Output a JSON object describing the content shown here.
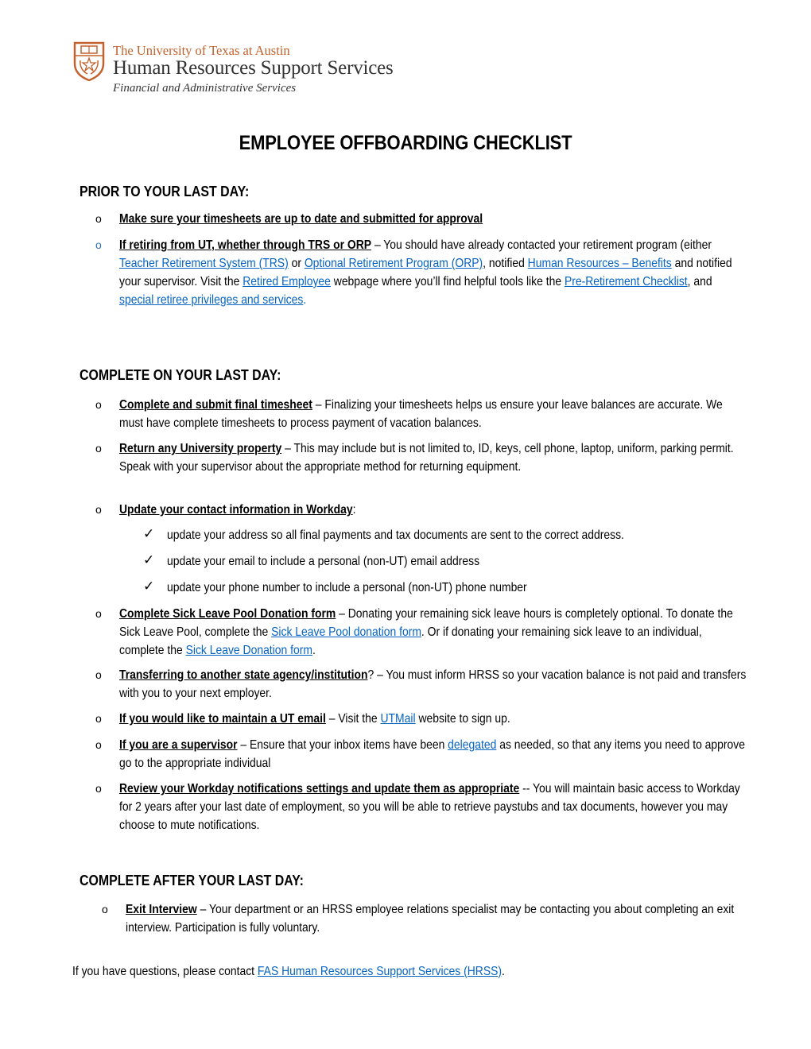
{
  "header": {
    "logo_icon": "ut-shield-icon",
    "line1": "The University of Texas at Austin",
    "line2": "Human Resources Support Services",
    "line3": "Financial and Administrative Services"
  },
  "title": "EMPLOYEE OFFBOARDING CHECKLIST",
  "colors": {
    "link": "#0563c1",
    "brand_orange": "#c4622d"
  },
  "sections": [
    {
      "heading": "PRIOR TO YOUR LAST DAY:",
      "items": [
        {
          "lead": "Make sure your timesheets are up to date and submitted for approval"
        },
        {
          "lead": "If retiring from UT, whether through TRS or ORP",
          "t1": " – You should have already contacted your retirement program (either ",
          "link1": "Teacher Retirement System (TRS)",
          "t2": " or ",
          "link2": "Optional Retirement Program (ORP)",
          "t3": ", notified ",
          "link3": "Human Resources – Benefits",
          "t4": " and notified your supervisor.  Visit the ",
          "link4": "Retired Employee",
          "t5": " webpage where you’ll find helpful tools like the ",
          "link5": "Pre-Retirement Checklist",
          "t6": ", and ",
          "link6": "special retiree privileges and services",
          "t7": "."
        }
      ]
    },
    {
      "heading": "COMPLETE ON YOUR LAST DAY:",
      "items": [
        {
          "lead": "Complete and submit final timesheet",
          "t1": " – Finalizing your timesheets helps us ensure your leave balances are accurate. We must have complete timesheets to process payment of vacation balances."
        },
        {
          "lead": "Return any University property",
          "t1": " – This may include but is not limited to, ID, keys, cell phone, laptop, uniform, parking permit. Speak with your supervisor about the appropriate method for returning equipment."
        },
        {
          "lead": "Update your contact information in Workday",
          "t1": ":",
          "subitems": [
            "update your address so all final payments and tax documents are sent to the correct address.",
            "update your email to include a personal (non-UT) email address",
            "update your phone number to include a personal (non-UT) phone number"
          ]
        },
        {
          "lead": "Complete Sick Leave Pool Donation form",
          "t1": " – Donating your remaining sick leave hours is completely optional. To donate the Sick Leave Pool, complete the ",
          "link1": "Sick Leave Pool donation form",
          "t2": ". Or if donating your remaining sick leave to an individual, complete the ",
          "link2": "Sick Leave Donation form",
          "t3": "."
        },
        {
          "lead": "Transferring to another state agency/institution",
          "t1": "? – You must inform HRSS so your vacation balance is not paid and transfers with you to your next employer."
        },
        {
          "lead": "If you would like to maintain a UT email",
          "t1": " – Visit the ",
          "link1": "UTMail",
          "t2": " website to sign up."
        },
        {
          "lead": "If you are a supervisor",
          "t1": " – Ensure that your inbox items have been ",
          "link1": "delegated",
          "t2": " as needed, so that any items you need to approve go to the appropriate individual"
        },
        {
          "lead": "Review your Workday notifications settings and update them as appropriate",
          "t1": " -- You will maintain basic access to Workday for 2 years after your last date of employment, so you will be able to retrieve paystubs and tax documents, however you may choose to mute notifications."
        }
      ]
    },
    {
      "heading": "COMPLETE AFTER YOUR LAST DAY:",
      "items": [
        {
          "lead": "Exit Interview",
          "t1": " – Your department or an HRSS employee relations specialist may be contacting you about completing an exit interview. Participation is fully voluntary."
        }
      ]
    }
  ],
  "footer": {
    "text": "If you have questions, please contact ",
    "link": "FAS Human Resources Support Services (HRSS)",
    "end": "."
  },
  "bullet_glyph": "o",
  "check_glyph": "✓"
}
